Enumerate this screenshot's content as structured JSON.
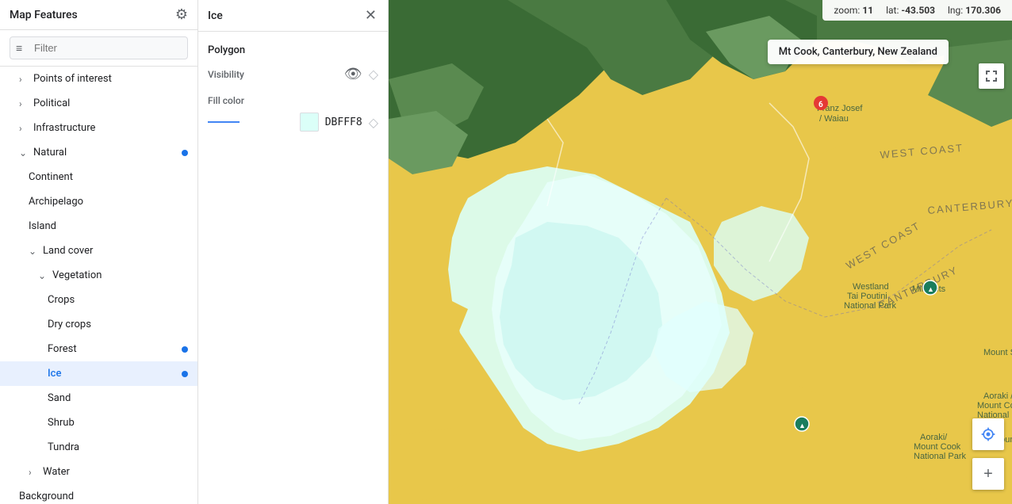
{
  "sidebar": {
    "title": "Map Features",
    "filter_placeholder": "Filter",
    "items": [
      {
        "id": "points-of-interest",
        "label": "Points of interest",
        "level": 0,
        "indent": 1,
        "expandable": true,
        "dot": false
      },
      {
        "id": "political",
        "label": "Political",
        "level": 0,
        "indent": 1,
        "expandable": true,
        "dot": false
      },
      {
        "id": "infrastructure",
        "label": "Infrastructure",
        "level": 0,
        "indent": 1,
        "expandable": true,
        "dot": false
      },
      {
        "id": "natural",
        "label": "Natural",
        "level": 0,
        "indent": 1,
        "expandable": true,
        "dot": true
      },
      {
        "id": "continent",
        "label": "Continent",
        "level": 1,
        "indent": 2,
        "expandable": false,
        "dot": false
      },
      {
        "id": "archipelago",
        "label": "Archipelago",
        "level": 1,
        "indent": 2,
        "expandable": false,
        "dot": false
      },
      {
        "id": "island",
        "label": "Island",
        "level": 1,
        "indent": 2,
        "expandable": false,
        "dot": false
      },
      {
        "id": "land-cover",
        "label": "Land cover",
        "level": 1,
        "indent": 2,
        "expandable": true,
        "dot": false
      },
      {
        "id": "vegetation",
        "label": "Vegetation",
        "level": 2,
        "indent": 3,
        "expandable": true,
        "dot": false
      },
      {
        "id": "crops",
        "label": "Crops",
        "level": 3,
        "indent": 4,
        "expandable": false,
        "dot": false
      },
      {
        "id": "dry-crops",
        "label": "Dry crops",
        "level": 3,
        "indent": 4,
        "expandable": false,
        "dot": false
      },
      {
        "id": "forest",
        "label": "Forest",
        "level": 3,
        "indent": 4,
        "expandable": false,
        "dot": true
      },
      {
        "id": "ice",
        "label": "Ice",
        "level": 3,
        "indent": 4,
        "expandable": false,
        "dot": true,
        "active": true
      },
      {
        "id": "sand",
        "label": "Sand",
        "level": 3,
        "indent": 4,
        "expandable": false,
        "dot": false
      },
      {
        "id": "shrub",
        "label": "Shrub",
        "level": 3,
        "indent": 4,
        "expandable": false,
        "dot": false
      },
      {
        "id": "tundra",
        "label": "Tundra",
        "level": 3,
        "indent": 4,
        "expandable": false,
        "dot": false
      },
      {
        "id": "water",
        "label": "Water",
        "level": 1,
        "indent": 2,
        "expandable": true,
        "dot": false
      },
      {
        "id": "background",
        "label": "Background",
        "level": 0,
        "indent": 1,
        "expandable": false,
        "dot": false
      }
    ]
  },
  "detail": {
    "title": "Ice",
    "section": "Polygon",
    "visibility_label": "Visibility",
    "fill_color_label": "Fill color",
    "fill_color_value": "DBFFF8",
    "fill_color_hex": "#DBFFF8"
  },
  "map": {
    "zoom_label": "zoom:",
    "zoom_value": "11",
    "lat_label": "lat:",
    "lat_value": "-43.503",
    "lng_label": "lng:",
    "lng_value": "170.306",
    "location_label": "Mt Cook, Canterbury, New Zealand",
    "fullscreen_icon": "⛶",
    "location_icon": "⊕",
    "plus_icon": "+"
  },
  "icons": {
    "gear": "⚙",
    "close": "✕",
    "filter": "≡",
    "eye": "👁",
    "diamond": "◇",
    "chevron_right": "›",
    "chevron_down": "⌄",
    "fullscreen": "⛶",
    "crosshair": "⊕"
  }
}
